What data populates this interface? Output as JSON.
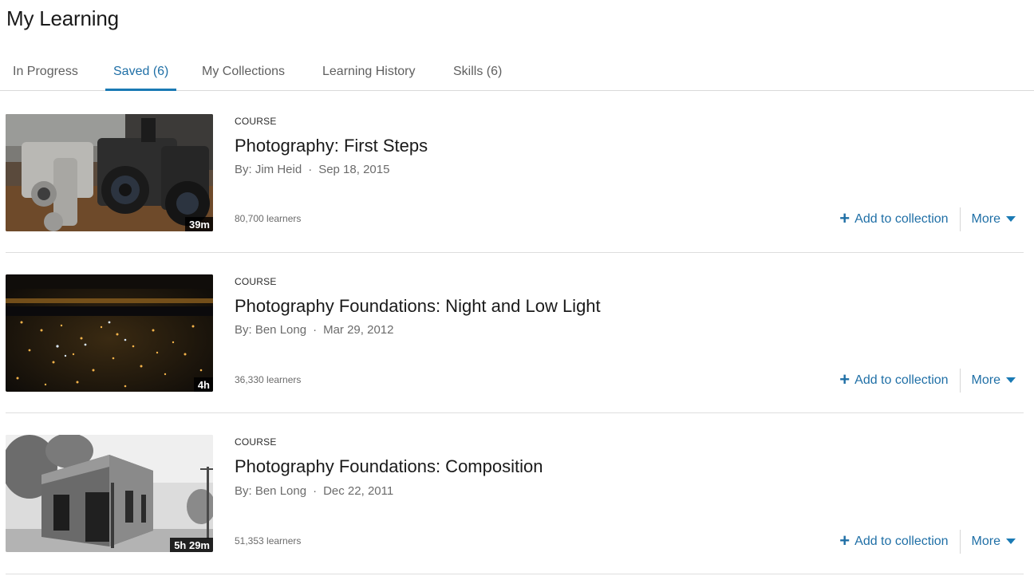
{
  "header": {
    "title": "My Learning"
  },
  "tabs": [
    {
      "label": "In Progress",
      "active": false
    },
    {
      "label": "Saved (6)",
      "active": true
    },
    {
      "label": "My Collections",
      "active": false
    },
    {
      "label": "Learning History",
      "active": false
    },
    {
      "label": "Skills (6)",
      "active": false
    }
  ],
  "colors": {
    "accent": "#1a7ab4",
    "link_text": "#1f6fa6",
    "muted_text": "#6b6b6b",
    "divider": "#dedede"
  },
  "courses": [
    {
      "type_label": "COURSE",
      "title": "Photography: First Steps",
      "author": "By: Jim Heid",
      "separator": "·",
      "date": "Sep 18, 2015",
      "learners": "80,700 learners",
      "duration": "39m",
      "thumbnail": "cameras-on-table-photo",
      "add_label": "Add to collection",
      "more_label": "More"
    },
    {
      "type_label": "COURSE",
      "title": "Photography Foundations: Night and Low Light",
      "author": "By: Ben Long",
      "separator": "·",
      "date": "Mar 29, 2012",
      "learners": "36,330 learners",
      "duration": "4h",
      "thumbnail": "city-lights-at-night-photo",
      "add_label": "Add to collection",
      "more_label": "More"
    },
    {
      "type_label": "COURSE",
      "title": "Photography Foundations: Composition",
      "author": "By: Ben Long",
      "separator": "·",
      "date": "Dec 22, 2011",
      "learners": "51,353 learners",
      "duration": "5h 29m",
      "thumbnail": "black-and-white-brick-building-photo",
      "add_label": "Add to collection",
      "more_label": "More"
    }
  ]
}
